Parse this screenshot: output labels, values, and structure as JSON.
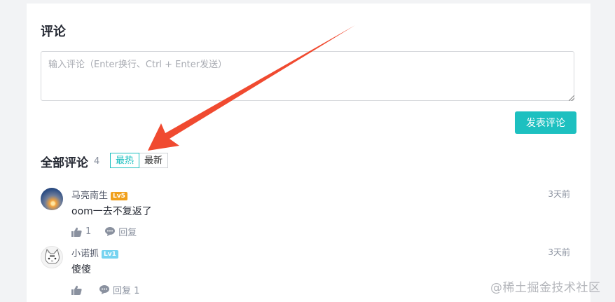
{
  "editor": {
    "title": "评论",
    "placeholder": "输入评论（Enter换行、Ctrl + Enter发送）",
    "submit_label": "发表评论"
  },
  "list": {
    "title": "全部评论",
    "count": "4",
    "sort_tabs": [
      "最热",
      "最新"
    ],
    "active_tab": "最热"
  },
  "comments": [
    {
      "username": "马亮南生",
      "level": "Lv5",
      "level_color": "#f0a01c",
      "time": "3天前",
      "content": "oom一去不复返了",
      "like_count": "1",
      "reply_label": "回复"
    },
    {
      "username": "小诺抓",
      "level": "Lv1",
      "level_color": "#76d3f0",
      "time": "3天前",
      "content": "傻傻",
      "like_count": "",
      "reply_label": "回复 1"
    }
  ],
  "annotation": {
    "arrow_color": "#f04a30"
  },
  "watermark": "@稀土掘金技术社区"
}
